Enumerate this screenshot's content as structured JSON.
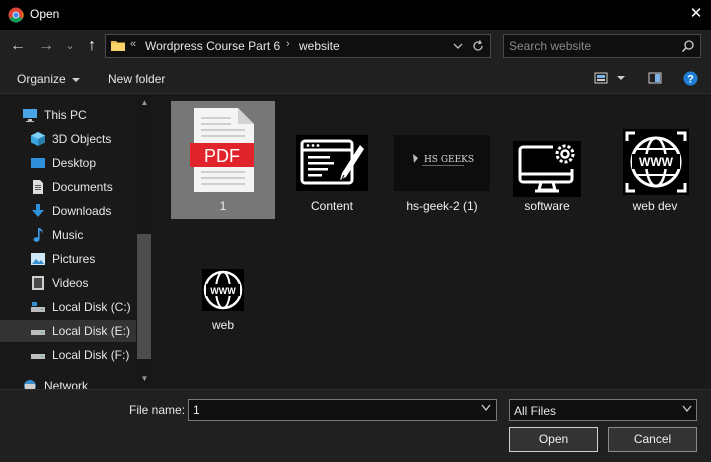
{
  "window": {
    "title": "Open",
    "close_glyph": "✕"
  },
  "nav": {
    "back_glyph": "←",
    "forward_glyph": "→",
    "recent_glyph": "⌄",
    "up_glyph": "↑",
    "breadcrumb_overflow": "«",
    "breadcrumbs": [
      "Wordpress Course  Part 6",
      "website"
    ],
    "separator": "›",
    "search_placeholder": "Search website"
  },
  "toolbar": {
    "organize_label": "Organize",
    "new_folder_label": "New folder"
  },
  "sidebar": {
    "items": [
      {
        "label": "This PC",
        "icon": "pc-icon"
      },
      {
        "label": "3D Objects",
        "icon": "3d-objects-icon"
      },
      {
        "label": "Desktop",
        "icon": "desktop-icon"
      },
      {
        "label": "Documents",
        "icon": "documents-icon"
      },
      {
        "label": "Downloads",
        "icon": "downloads-icon"
      },
      {
        "label": "Music",
        "icon": "music-icon"
      },
      {
        "label": "Pictures",
        "icon": "pictures-icon"
      },
      {
        "label": "Videos",
        "icon": "videos-icon"
      },
      {
        "label": "Local Disk (C:)",
        "icon": "drive-c-icon"
      },
      {
        "label": "Local Disk (E:)",
        "icon": "drive-icon",
        "selected": true
      },
      {
        "label": "Local Disk (F:)",
        "icon": "drive-icon"
      },
      {
        "label": "Network",
        "icon": "network-icon"
      }
    ]
  },
  "files": [
    {
      "name": "1",
      "icon": "pdf-icon",
      "selected": true,
      "badge_text": "PDF"
    },
    {
      "name": "Content",
      "icon": "content-editor-icon"
    },
    {
      "name": "hs-geek-2 (1)",
      "icon": "hs-geeks-logo-icon",
      "logo_text": "HS GEEKS"
    },
    {
      "name": "software",
      "icon": "software-settings-icon"
    },
    {
      "name": "web dev",
      "icon": "web-dev-globe-icon",
      "badge_text": "WWW"
    },
    {
      "name": "web",
      "icon": "www-globe-icon",
      "badge_text": "WWW"
    }
  ],
  "footer": {
    "file_name_label": "File name:",
    "file_name_value": "1",
    "file_type_value": "All Files",
    "open_label": "Open",
    "cancel_label": "Cancel"
  },
  "colors": {
    "background": "#191919",
    "titlebar": "#000000",
    "pdf_red": "#e1242c",
    "selection": "#777777",
    "help_blue": "#1e7fd8"
  }
}
